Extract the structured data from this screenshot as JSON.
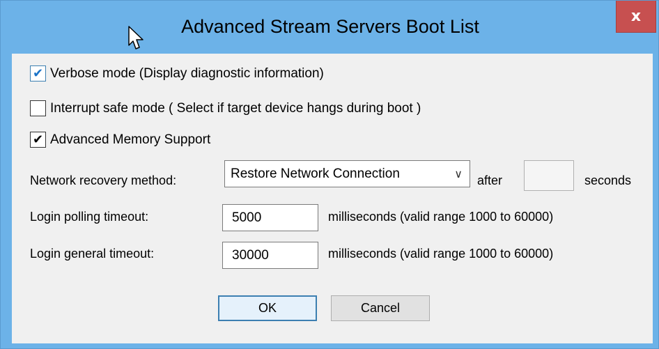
{
  "window": {
    "title": "Advanced Stream Servers Boot List",
    "close_glyph": "x",
    "accent": "#6cb2e8",
    "close_color": "#c75050"
  },
  "options": {
    "verbose": {
      "label": "Verbose mode (Display diagnostic information)",
      "checked": true
    },
    "interrupt_safe": {
      "label": "Interrupt safe mode ( Select if target device hangs during boot )",
      "checked": false
    },
    "advanced_memory": {
      "label": "Advanced Memory Support",
      "checked": true
    }
  },
  "network": {
    "label": "Network recovery method:",
    "selected": "Restore Network Connection",
    "after_label": "after",
    "seconds_value": "",
    "seconds_label": "seconds"
  },
  "polling": {
    "label": "Login polling timeout:",
    "value": "5000",
    "hint": "milliseconds (valid range 1000 to 60000)"
  },
  "general": {
    "label": "Login general timeout:",
    "value": "30000",
    "hint": "milliseconds (valid range 1000 to 60000)"
  },
  "buttons": {
    "ok": "OK",
    "cancel": "Cancel"
  },
  "icons": {
    "check": "check-icon",
    "dropdown": "chevron-down-icon",
    "pointer": "mouse-pointer-icon"
  }
}
